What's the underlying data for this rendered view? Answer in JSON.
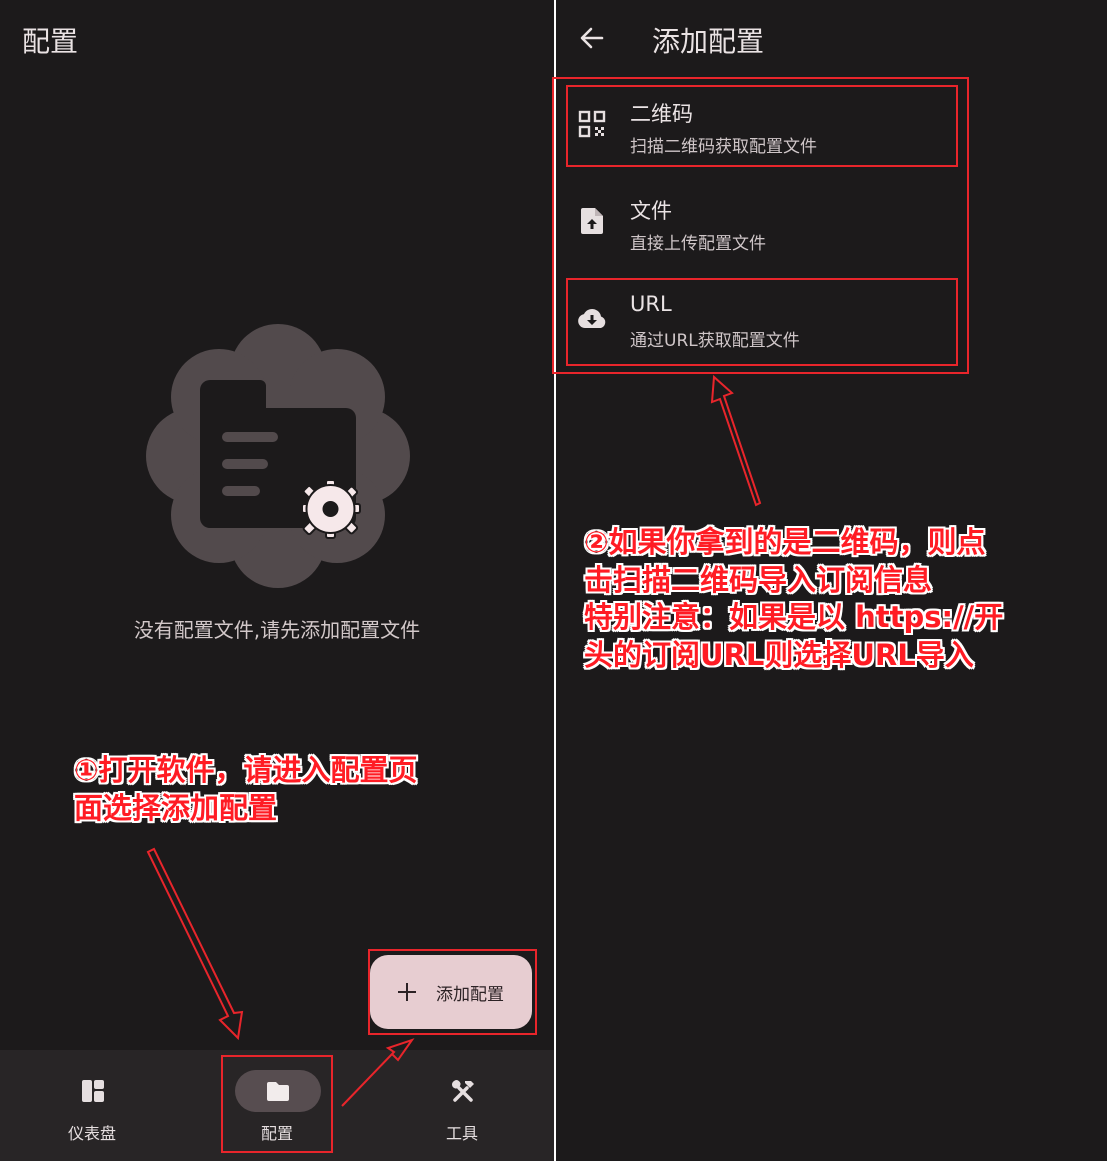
{
  "left_screen": {
    "title": "配置",
    "empty_message": "没有配置文件,请先添加配置文件",
    "fab_label": "添加配置",
    "nav": [
      {
        "label": "仪表盘",
        "icon": "dashboard-icon",
        "active": false
      },
      {
        "label": "配置",
        "icon": "folder-icon",
        "active": true
      },
      {
        "label": "工具",
        "icon": "tools-icon",
        "active": false
      }
    ]
  },
  "right_screen": {
    "title": "添加配置",
    "options": [
      {
        "title": "二维码",
        "subtitle": "扫描二维码获取配置文件",
        "icon": "qr-code-icon"
      },
      {
        "title": "文件",
        "subtitle": "直接上传配置文件",
        "icon": "file-upload-icon"
      },
      {
        "title": "URL",
        "subtitle": "通过URL获取配置文件",
        "icon": "cloud-download-icon"
      }
    ]
  },
  "annotations": {
    "step1": [
      "①打开软件，请进入配置页",
      "面选择添加配置"
    ],
    "step2": [
      "②如果你拿到的是二维码，则点",
      "击扫描二维码导入订阅信息",
      "特别注意：如果是以 https://开",
      "头的订阅URL则选择URL导入"
    ]
  },
  "colors": {
    "background": "#1c1a1b",
    "nav_background": "#282526",
    "fab_background": "#e7cdd1",
    "active_pill": "#574d50",
    "annotation_red": "#e8252b"
  }
}
